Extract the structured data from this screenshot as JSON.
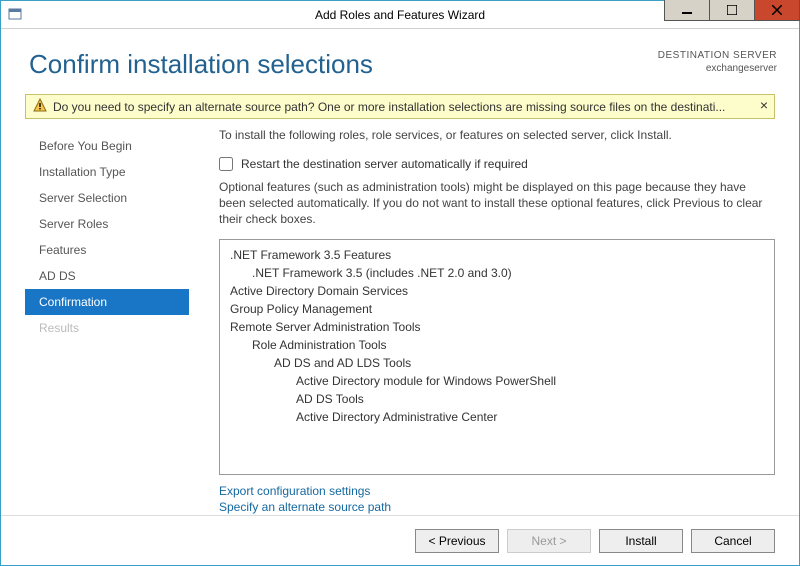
{
  "window": {
    "title": "Add Roles and Features Wizard"
  },
  "header": {
    "page_title": "Confirm installation selections",
    "dest_label": "DESTINATION SERVER",
    "dest_name": "exchangeserver"
  },
  "notice": {
    "text": "Do you need to specify an alternate source path? One or more installation selections are missing source files on the destinati..."
  },
  "sidebar": {
    "items": [
      {
        "label": "Before You Begin",
        "active": false,
        "disabled": false
      },
      {
        "label": "Installation Type",
        "active": false,
        "disabled": false
      },
      {
        "label": "Server Selection",
        "active": false,
        "disabled": false
      },
      {
        "label": "Server Roles",
        "active": false,
        "disabled": false
      },
      {
        "label": "Features",
        "active": false,
        "disabled": false
      },
      {
        "label": "AD DS",
        "active": false,
        "disabled": false
      },
      {
        "label": "Confirmation",
        "active": true,
        "disabled": false
      },
      {
        "label": "Results",
        "active": false,
        "disabled": true
      }
    ]
  },
  "content": {
    "intro": "To install the following roles, role services, or features on selected server, click Install.",
    "restart_label": "Restart the destination server automatically if required",
    "optional_note": "Optional features (such as administration tools) might be displayed on this page because they have been selected automatically. If you do not want to install these optional features, click Previous to clear their check boxes.",
    "list": [
      {
        "text": ".NET Framework 3.5 Features",
        "level": 0
      },
      {
        "text": ".NET Framework 3.5 (includes .NET 2.0 and 3.0)",
        "level": 1
      },
      {
        "text": "Active Directory Domain Services",
        "level": 0
      },
      {
        "text": "Group Policy Management",
        "level": 0
      },
      {
        "text": "Remote Server Administration Tools",
        "level": 0
      },
      {
        "text": "Role Administration Tools",
        "level": 1
      },
      {
        "text": "AD DS and AD LDS Tools",
        "level": 2
      },
      {
        "text": "Active Directory module for Windows PowerShell",
        "level": 3
      },
      {
        "text": "AD DS Tools",
        "level": 3
      },
      {
        "text": "Active Directory Administrative Center",
        "level": 3
      }
    ],
    "link_export": "Export configuration settings",
    "link_source": "Specify an alternate source path"
  },
  "buttons": {
    "previous": "< Previous",
    "next": "Next >",
    "install": "Install",
    "cancel": "Cancel"
  }
}
